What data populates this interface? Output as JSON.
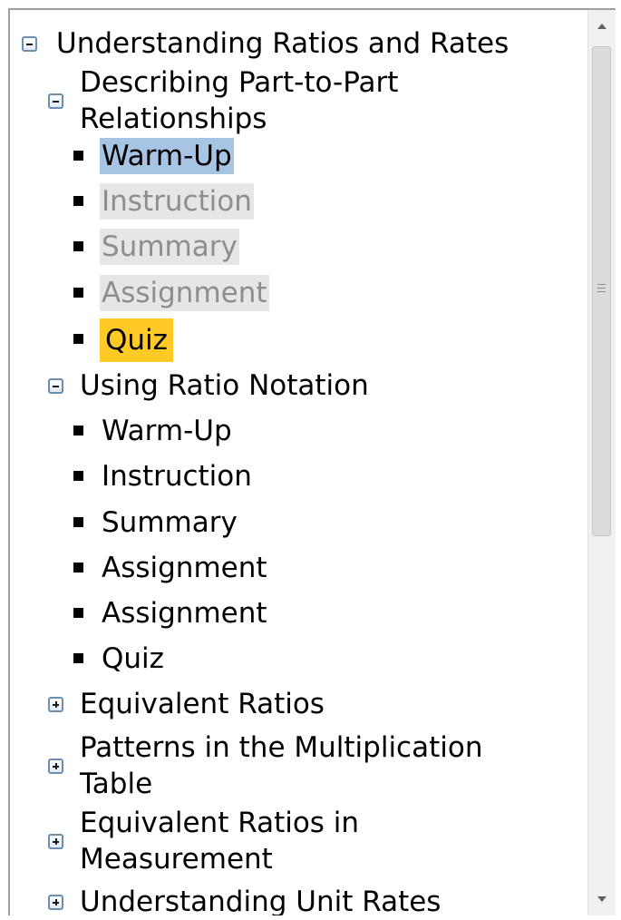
{
  "unit": {
    "title": "Understanding Ratios and Rates",
    "expanded": true,
    "lessons": [
      {
        "title_line1": "Describing Part-to-Part",
        "title_line2": "Relationships",
        "expanded": true,
        "items": [
          {
            "label": "Warm-Up",
            "state": "current"
          },
          {
            "label": "Instruction",
            "state": "locked"
          },
          {
            "label": "Summary",
            "state": "locked"
          },
          {
            "label": "Assignment",
            "state": "locked"
          },
          {
            "label": "Quiz",
            "state": "due"
          }
        ]
      },
      {
        "title_line1": "Using Ratio Notation",
        "expanded": true,
        "items": [
          {
            "label": "Warm-Up"
          },
          {
            "label": "Instruction"
          },
          {
            "label": "Summary"
          },
          {
            "label": "Assignment"
          },
          {
            "label": "Assignment"
          },
          {
            "label": "Quiz"
          }
        ]
      },
      {
        "title_line1": "Equivalent Ratios",
        "expanded": false
      },
      {
        "title_line1": "Patterns in the Multiplication",
        "title_line2": "Table",
        "expanded": false
      },
      {
        "title_line1": "Equivalent Ratios in",
        "title_line2": "Measurement",
        "expanded": false
      },
      {
        "title_line1": "Understanding Unit Rates",
        "expanded": false
      }
    ]
  },
  "colors": {
    "current_highlight": "#a8c4e4",
    "locked_highlight": "#e6e6e6",
    "locked_text": "#8e8e8e",
    "due_highlight": "#ffc926"
  }
}
